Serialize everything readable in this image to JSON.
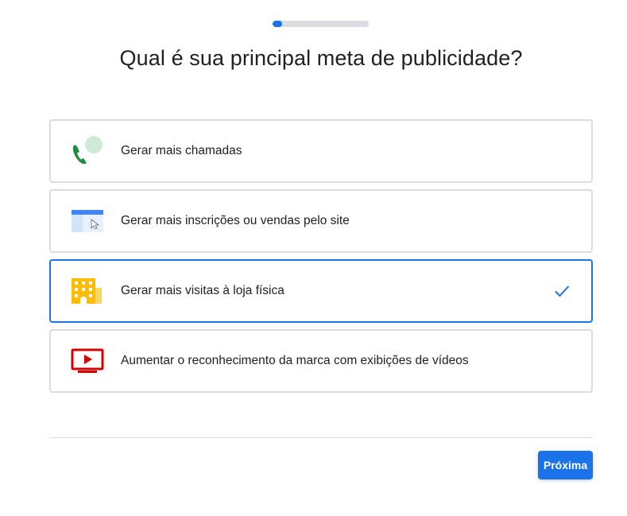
{
  "progress": {
    "fraction": 0.1
  },
  "title": "Qual é sua principal meta de publicidade?",
  "options": [
    {
      "label": "Gerar mais chamadas",
      "icon": "phone-call-icon",
      "selected": false
    },
    {
      "label": "Gerar mais inscrições ou vendas pelo site",
      "icon": "website-click-icon",
      "selected": false
    },
    {
      "label": "Gerar mais visitas à loja física",
      "icon": "store-building-icon",
      "selected": true
    },
    {
      "label": "Aumentar o reconhecimento da marca com exibições de vídeos",
      "icon": "video-play-icon",
      "selected": false
    }
  ],
  "next_button": {
    "label": "Próxima"
  },
  "colors": {
    "accent": "#1a73e8",
    "border": "#dadce0",
    "phone_green": "#1e8e3e",
    "bubble_green": "#ceead6",
    "browser_blue": "#4285f4",
    "store_yellow": "#fbbc04",
    "video_red": "#d50000"
  }
}
